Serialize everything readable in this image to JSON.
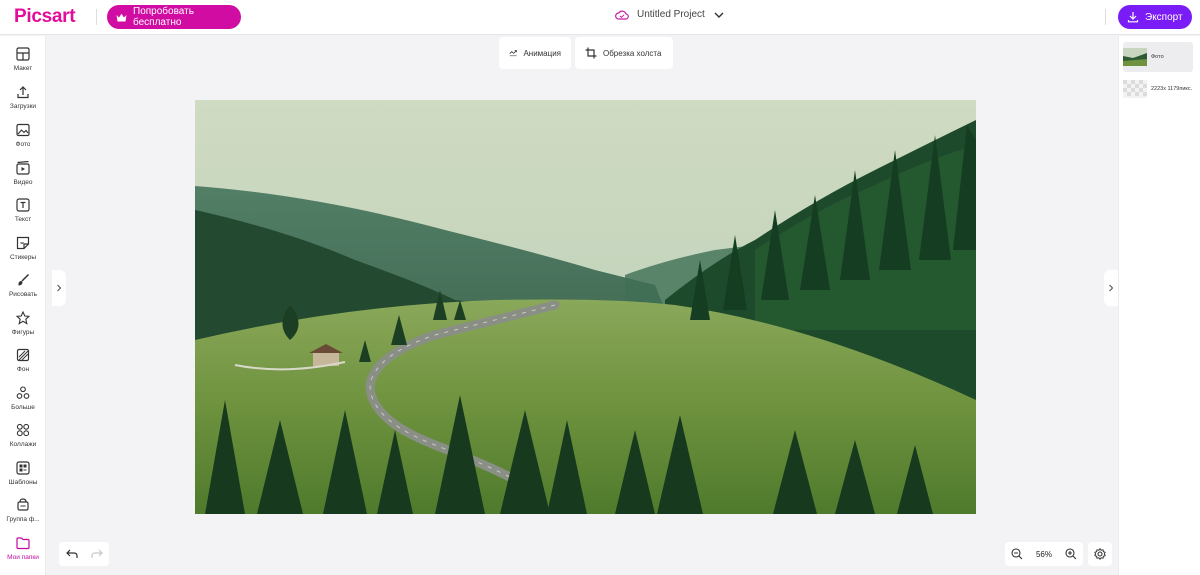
{
  "app": {
    "logo": "Picsart",
    "brand_color": "#e20e9b",
    "accent_export": "#7a1cf5"
  },
  "header": {
    "try_free_label": "Попробовать бесплатно",
    "project_name": "Untitled Project",
    "export_label": "Экспорт"
  },
  "sidebar": {
    "items": [
      {
        "label": "Макет",
        "icon": "layout-icon"
      },
      {
        "label": "Загрузки",
        "icon": "upload-icon"
      },
      {
        "label": "Фото",
        "icon": "photo-icon"
      },
      {
        "label": "Видео",
        "icon": "video-icon"
      },
      {
        "label": "Текст",
        "icon": "text-icon"
      },
      {
        "label": "Стикеры",
        "icon": "sticker-icon"
      },
      {
        "label": "Рисовать",
        "icon": "brush-icon"
      },
      {
        "label": "Фигуры",
        "icon": "star-icon"
      },
      {
        "label": "Фон",
        "icon": "background-icon"
      },
      {
        "label": "Больше",
        "icon": "more-icon"
      },
      {
        "label": "Коллажи",
        "icon": "collage-icon"
      },
      {
        "label": "Шаблоны",
        "icon": "templates-icon"
      },
      {
        "label": "Группа ф...",
        "icon": "group-icon"
      },
      {
        "label": "Мои папки",
        "icon": "folder-icon"
      }
    ]
  },
  "canvas_toolbar": {
    "animation_label": "Анимация",
    "crop_label": "Обрезка холста"
  },
  "layers": {
    "items": [
      {
        "name": "Фото"
      },
      {
        "name": "2223x 1179пикс."
      }
    ]
  },
  "zoom": {
    "level": "56%"
  }
}
